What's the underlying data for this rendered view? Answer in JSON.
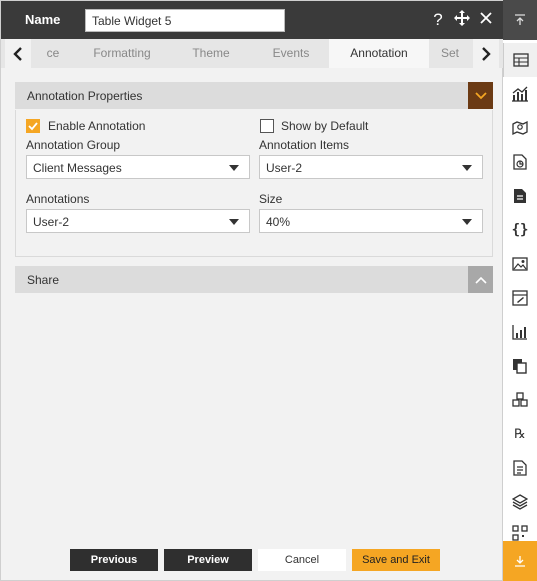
{
  "header": {
    "name_label": "Name",
    "name_value": "Table Widget 5",
    "icons": [
      "help-icon",
      "move-icon",
      "close-icon"
    ]
  },
  "tabs": [
    {
      "label": "ce"
    },
    {
      "label": "Formatting"
    },
    {
      "label": "Theme"
    },
    {
      "label": "Events"
    },
    {
      "label": "Annotation",
      "active": true
    },
    {
      "label": "Set"
    }
  ],
  "annotation_section": {
    "title": "Annotation Properties",
    "enable_annotation": {
      "label": "Enable Annotation",
      "checked": true
    },
    "show_by_default": {
      "label": "Show by Default",
      "checked": false
    },
    "annotation_group": {
      "label": "Annotation Group",
      "value": "Client Messages"
    },
    "annotation_items": {
      "label": "Annotation Items",
      "value": "User-2"
    },
    "annotations": {
      "label": "Annotations",
      "value": "User-2"
    },
    "size": {
      "label": "Size",
      "value": "40%"
    }
  },
  "share_section": {
    "title": "Share"
  },
  "footer": {
    "previous": "Previous",
    "preview": "Preview",
    "cancel": "Cancel",
    "save_exit": "Save and Exit"
  },
  "colors": {
    "accent": "#f5a623",
    "header_bg": "#3a3a3a",
    "dark_button": "#2f2f2f"
  },
  "rail_icons": [
    "scroll-top-icon",
    "table-icon",
    "chart-icon",
    "map-icon",
    "document-chart-icon",
    "file-icon",
    "code-braces-icon",
    "image-icon",
    "edit-board-icon",
    "bar-chart-icon",
    "copy-icon",
    "cubes-icon",
    "rx-icon",
    "report-icon",
    "layers-icon",
    "qr-icon",
    "scroll-bottom-icon"
  ]
}
